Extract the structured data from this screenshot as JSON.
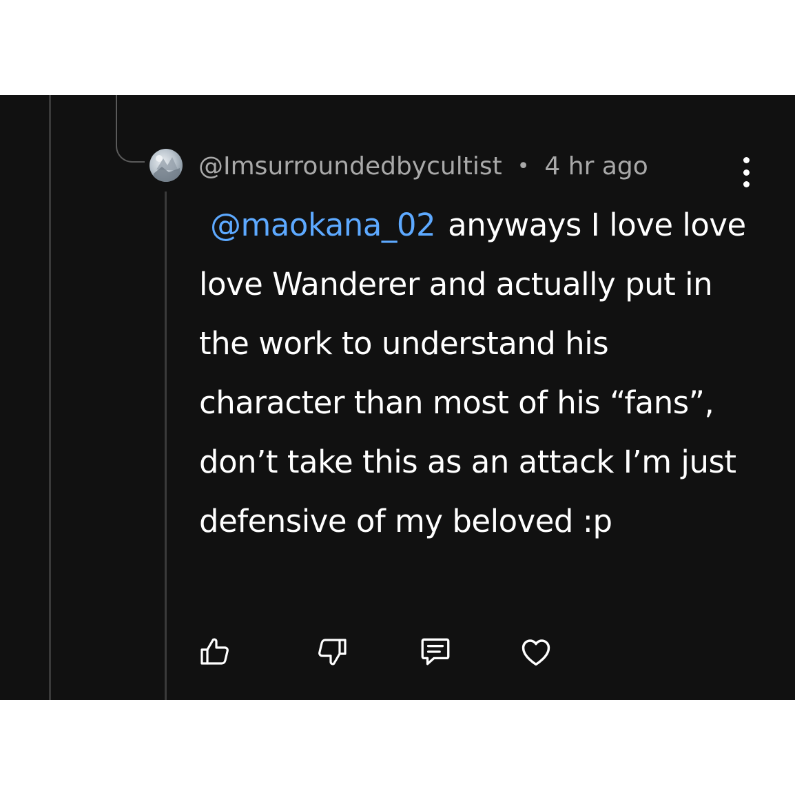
{
  "comment": {
    "username": "@Imsurroundedbycultist",
    "separator": "•",
    "time": "4 hr ago",
    "mention": "@maokana_02",
    "text": "anyways I love love love Wanderer and actually put in the work to understand his character than most of his “fans”, don’t take this as an attack I’m just defensive of my beloved :p"
  },
  "icons": {
    "menu": "more-vertical-icon",
    "like": "thumbs-up-icon",
    "dislike": "thumbs-down-icon",
    "reply": "reply-comment-icon",
    "heart": "heart-icon"
  },
  "colors": {
    "background": "#111111",
    "text": "#ffffff",
    "meta": "#a9a9a9",
    "mention": "#5da9ff"
  }
}
